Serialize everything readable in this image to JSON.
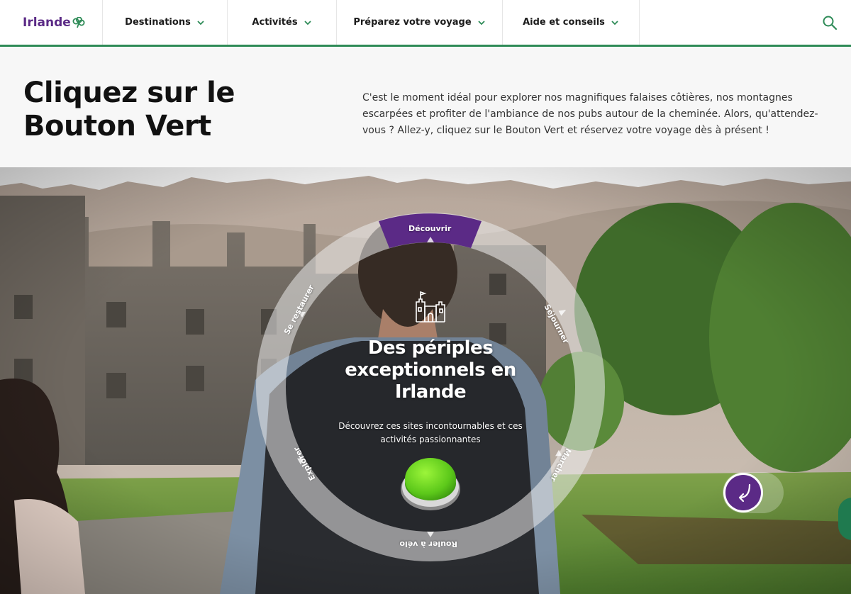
{
  "brand": {
    "name": "Irlande",
    "logo_icon": "shamrock-icon",
    "primary_color": "#5b2a86",
    "accent_color": "#2e8b57"
  },
  "nav": {
    "items": [
      {
        "label": "Destinations"
      },
      {
        "label": "Activités"
      },
      {
        "label": "Préparez votre voyage"
      },
      {
        "label": "Aide et conseils"
      }
    ],
    "search_icon": "search-icon"
  },
  "intro": {
    "title": "Cliquez sur le Bouton Vert",
    "text": "C'est le moment idéal pour explorer nos magnifiques falaises côtières, nos montagnes escarpées et profiter de l'ambiance de nos pubs autour de la cheminée. Alors, qu'attendez-vous ? Allez-y, cliquez sur le Bouton Vert et réservez votre voyage dès à présent !"
  },
  "wheel": {
    "segments": [
      {
        "label": "Découvrir",
        "active": true
      },
      {
        "label": "Séjourner",
        "active": false
      },
      {
        "label": "Marcher",
        "active": false
      },
      {
        "label": "Rouler à vélo",
        "active": false
      },
      {
        "label": "Explorer",
        "active": false
      },
      {
        "label": "Se restaurer",
        "active": false
      }
    ],
    "center_icon": "castle-icon",
    "title": "Des périples exceptionnels en Irlande",
    "subtitle": "Découvrez ces sites incontournables et ces activités passionnantes",
    "button_icon": "green-button-icon"
  },
  "controls": {
    "back_icon": "return-arrow-icon",
    "chat_icon": "chat-icon"
  }
}
